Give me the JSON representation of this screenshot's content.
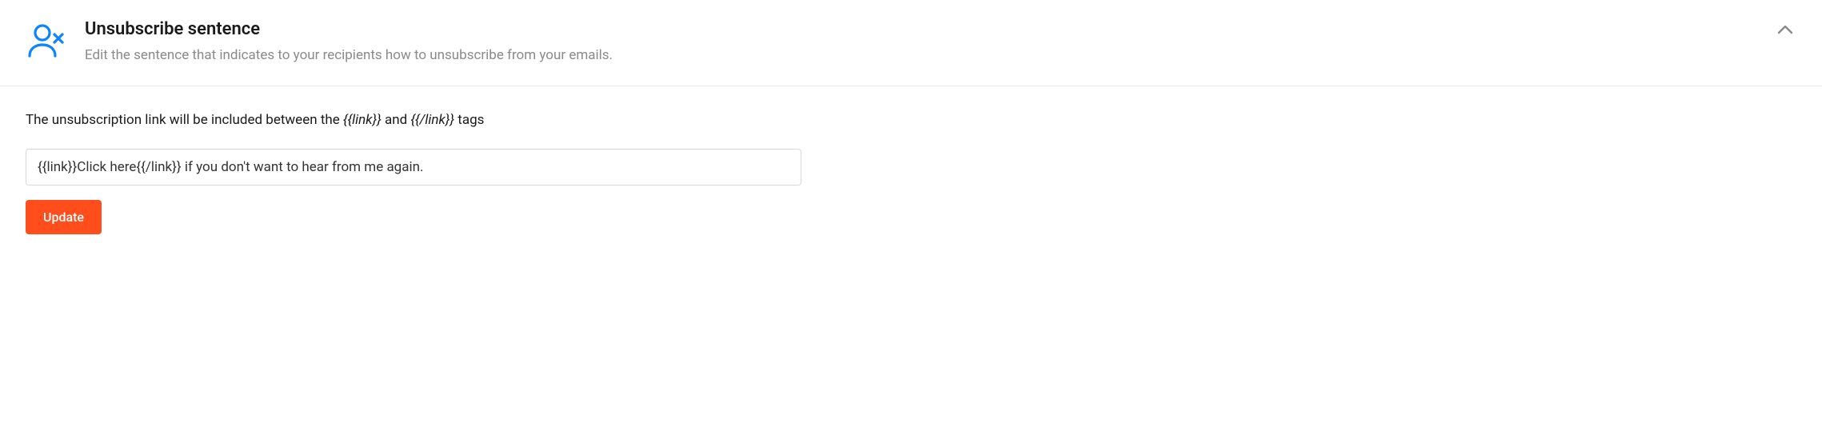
{
  "header": {
    "title": "Unsubscribe sentence",
    "subtitle": "Edit the sentence that indicates to your recipients how to unsubscribe from your emails."
  },
  "content": {
    "helper_prefix": "The unsubscription link will be included between the ",
    "tag_open": "{{link}}",
    "helper_middle": " and ",
    "tag_close": "{{/link}}",
    "helper_suffix": " tags",
    "input_value": "{{link}}Click here{{/link}} if you don't want to hear from me again.",
    "update_label": "Update"
  }
}
